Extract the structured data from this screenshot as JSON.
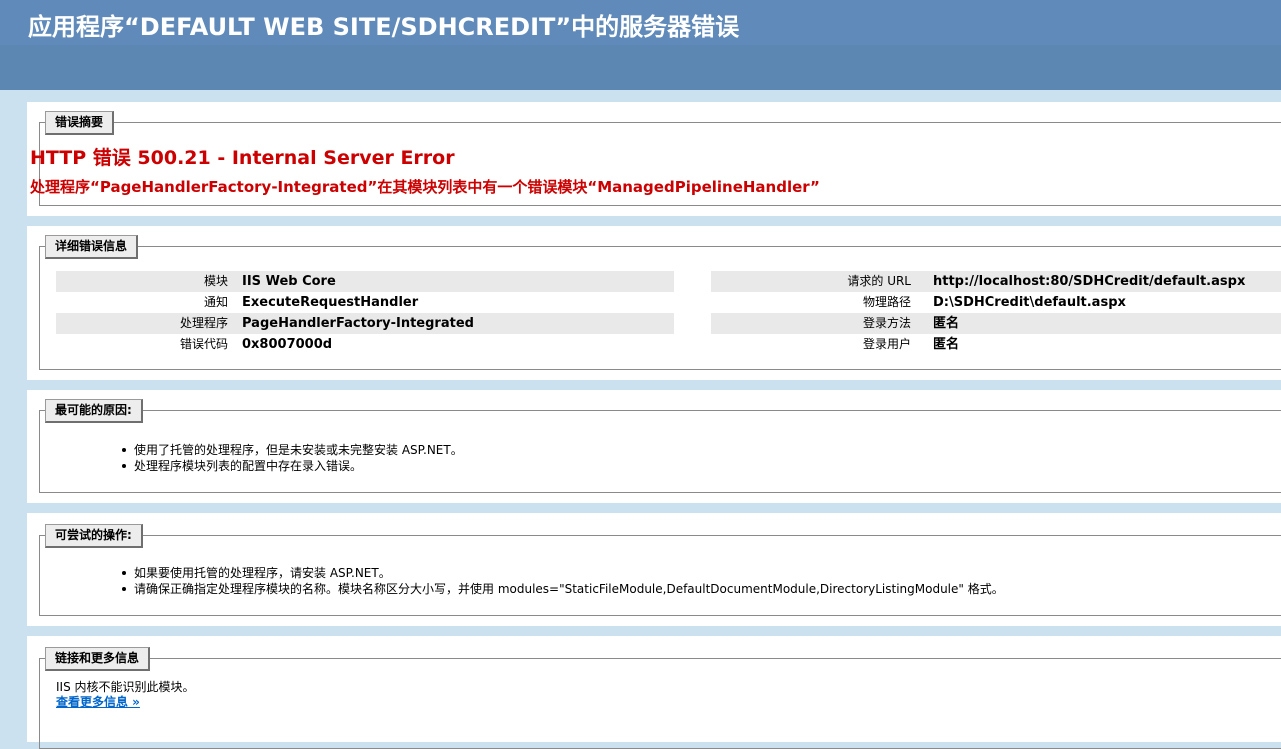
{
  "page": {
    "title": "应用程序“DEFAULT WEB SITE/SDHCREDIT”中的服务器错误"
  },
  "summary": {
    "legend": "错误摘要",
    "error_title": "HTTP 错误 500.21 - Internal Server Error",
    "error_detail": "处理程序“PageHandlerFactory-Integrated”在其模块列表中有一个错误模块“ManagedPipelineHandler”"
  },
  "details": {
    "legend": "详细错误信息",
    "left": [
      {
        "label": "模块",
        "value": "IIS Web Core"
      },
      {
        "label": "通知",
        "value": "ExecuteRequestHandler"
      },
      {
        "label": "处理程序",
        "value": "PageHandlerFactory-Integrated"
      },
      {
        "label": "错误代码",
        "value": "0x8007000d"
      }
    ],
    "right": [
      {
        "label": "请求的 URL",
        "value": "http://localhost:80/SDHCredit/default.aspx"
      },
      {
        "label": "物理路径",
        "value": "D:\\SDHCredit\\default.aspx"
      },
      {
        "label": "登录方法",
        "value": "匿名"
      },
      {
        "label": "登录用户",
        "value": "匿名"
      }
    ]
  },
  "causes": {
    "legend": "最可能的原因:",
    "items": [
      "使用了托管的处理程序，但是未安装或未完整安装 ASP.NET。",
      "处理程序模块列表的配置中存在录入错误。"
    ]
  },
  "actions": {
    "legend": "可尝试的操作:",
    "items": [
      "如果要使用托管的处理程序，请安装 ASP.NET。",
      "请确保正确指定处理程序模块的名称。模块名称区分大小写，并使用 modules=\"StaticFileModule,DefaultDocumentModule,DirectoryListingModule\" 格式。"
    ]
  },
  "links": {
    "legend": "链接和更多信息",
    "text": "IIS 内核不能识别此模块。",
    "more_link": "查看更多信息 »"
  }
}
